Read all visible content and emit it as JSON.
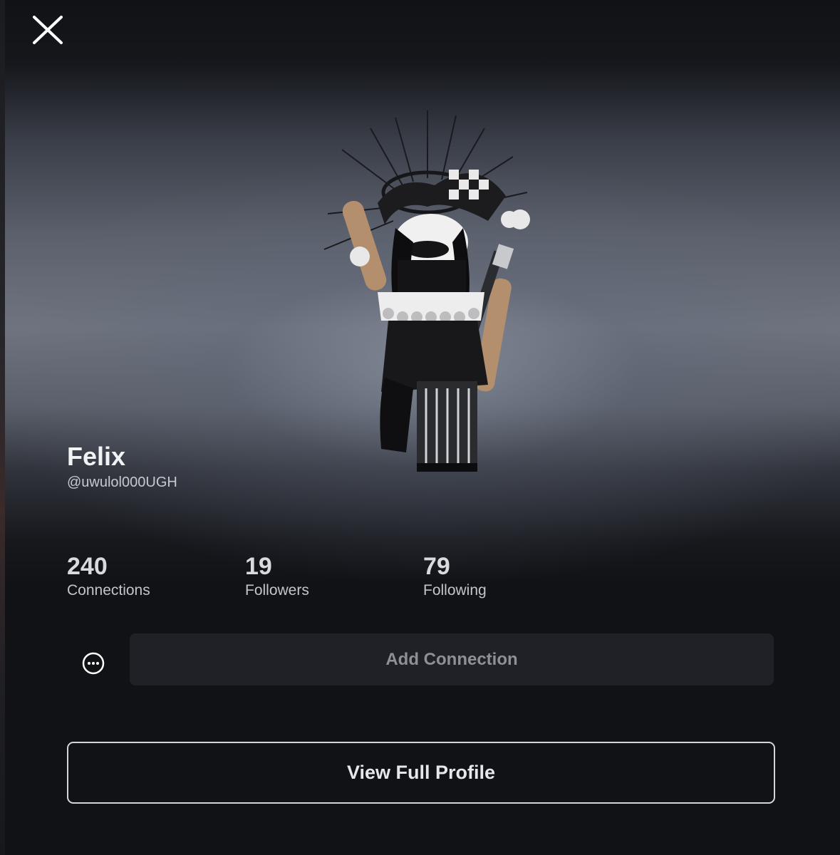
{
  "profile": {
    "display_name": "Felix",
    "username": "@uwulol000UGH"
  },
  "stats": [
    {
      "value": "240",
      "label": "Connections"
    },
    {
      "value": "19",
      "label": "Followers"
    },
    {
      "value": "79",
      "label": "Following"
    }
  ],
  "actions": {
    "add_connection_label": "Add Connection",
    "view_profile_label": "View Full Profile"
  },
  "icons": {
    "close": "close-icon",
    "more": "more-options-icon"
  },
  "colors": {
    "background": "#111216",
    "button_secondary": "#1f2126",
    "text_primary": "#f2f3f5"
  }
}
